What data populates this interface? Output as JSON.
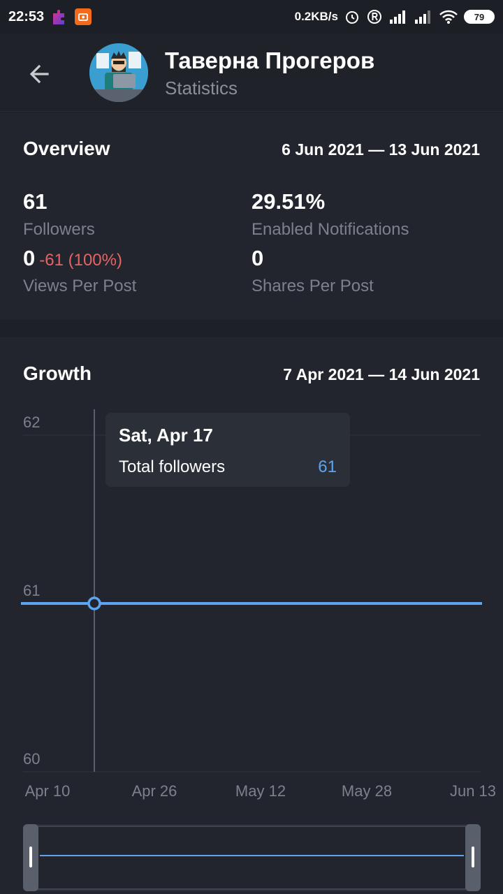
{
  "status_bar": {
    "time": "22:53",
    "network_speed": "0.2KB/s",
    "battery": "79",
    "icons": [
      "alarm-icon",
      "roaming-icon",
      "signal-icon",
      "signal-icon",
      "wifi-icon",
      "battery-icon"
    ]
  },
  "header": {
    "title": "Таверна Прогеров",
    "subtitle": "Statistics",
    "back_icon": "arrow-left-icon"
  },
  "overview": {
    "title": "Overview",
    "range": "6 Jun 2021 — 13 Jun 2021",
    "stats": {
      "followers": {
        "value": "61",
        "label": "Followers"
      },
      "notifications": {
        "value": "29.51%",
        "label": "Enabled Notifications"
      },
      "views": {
        "value": "0",
        "delta": "-61 (100%)",
        "label": "Views Per Post"
      },
      "shares": {
        "value": "0",
        "label": "Shares Per Post"
      }
    }
  },
  "growth": {
    "title": "Growth",
    "range": "7 Apr 2021 — 14 Jun 2021",
    "tooltip": {
      "date": "Sat, Apr 17",
      "label": "Total followers",
      "value": "61"
    }
  },
  "colors": {
    "accent": "#5da4f0",
    "negative": "#e26565",
    "background": "#1d2027",
    "card": "#22252d"
  },
  "chart_data": {
    "type": "line",
    "x": [
      "Apr 7",
      "Apr 17",
      "Jun 14"
    ],
    "series": [
      {
        "values": [
          61,
          61,
          61
        ]
      }
    ],
    "x_tick_labels": [
      "Apr 10",
      "Apr 26",
      "May 12",
      "May 28",
      "Jun 13"
    ],
    "y_tick_labels": [
      "62",
      "61",
      "60"
    ],
    "ylim": [
      60,
      62
    ],
    "grid": true,
    "highlight_index": 1
  }
}
